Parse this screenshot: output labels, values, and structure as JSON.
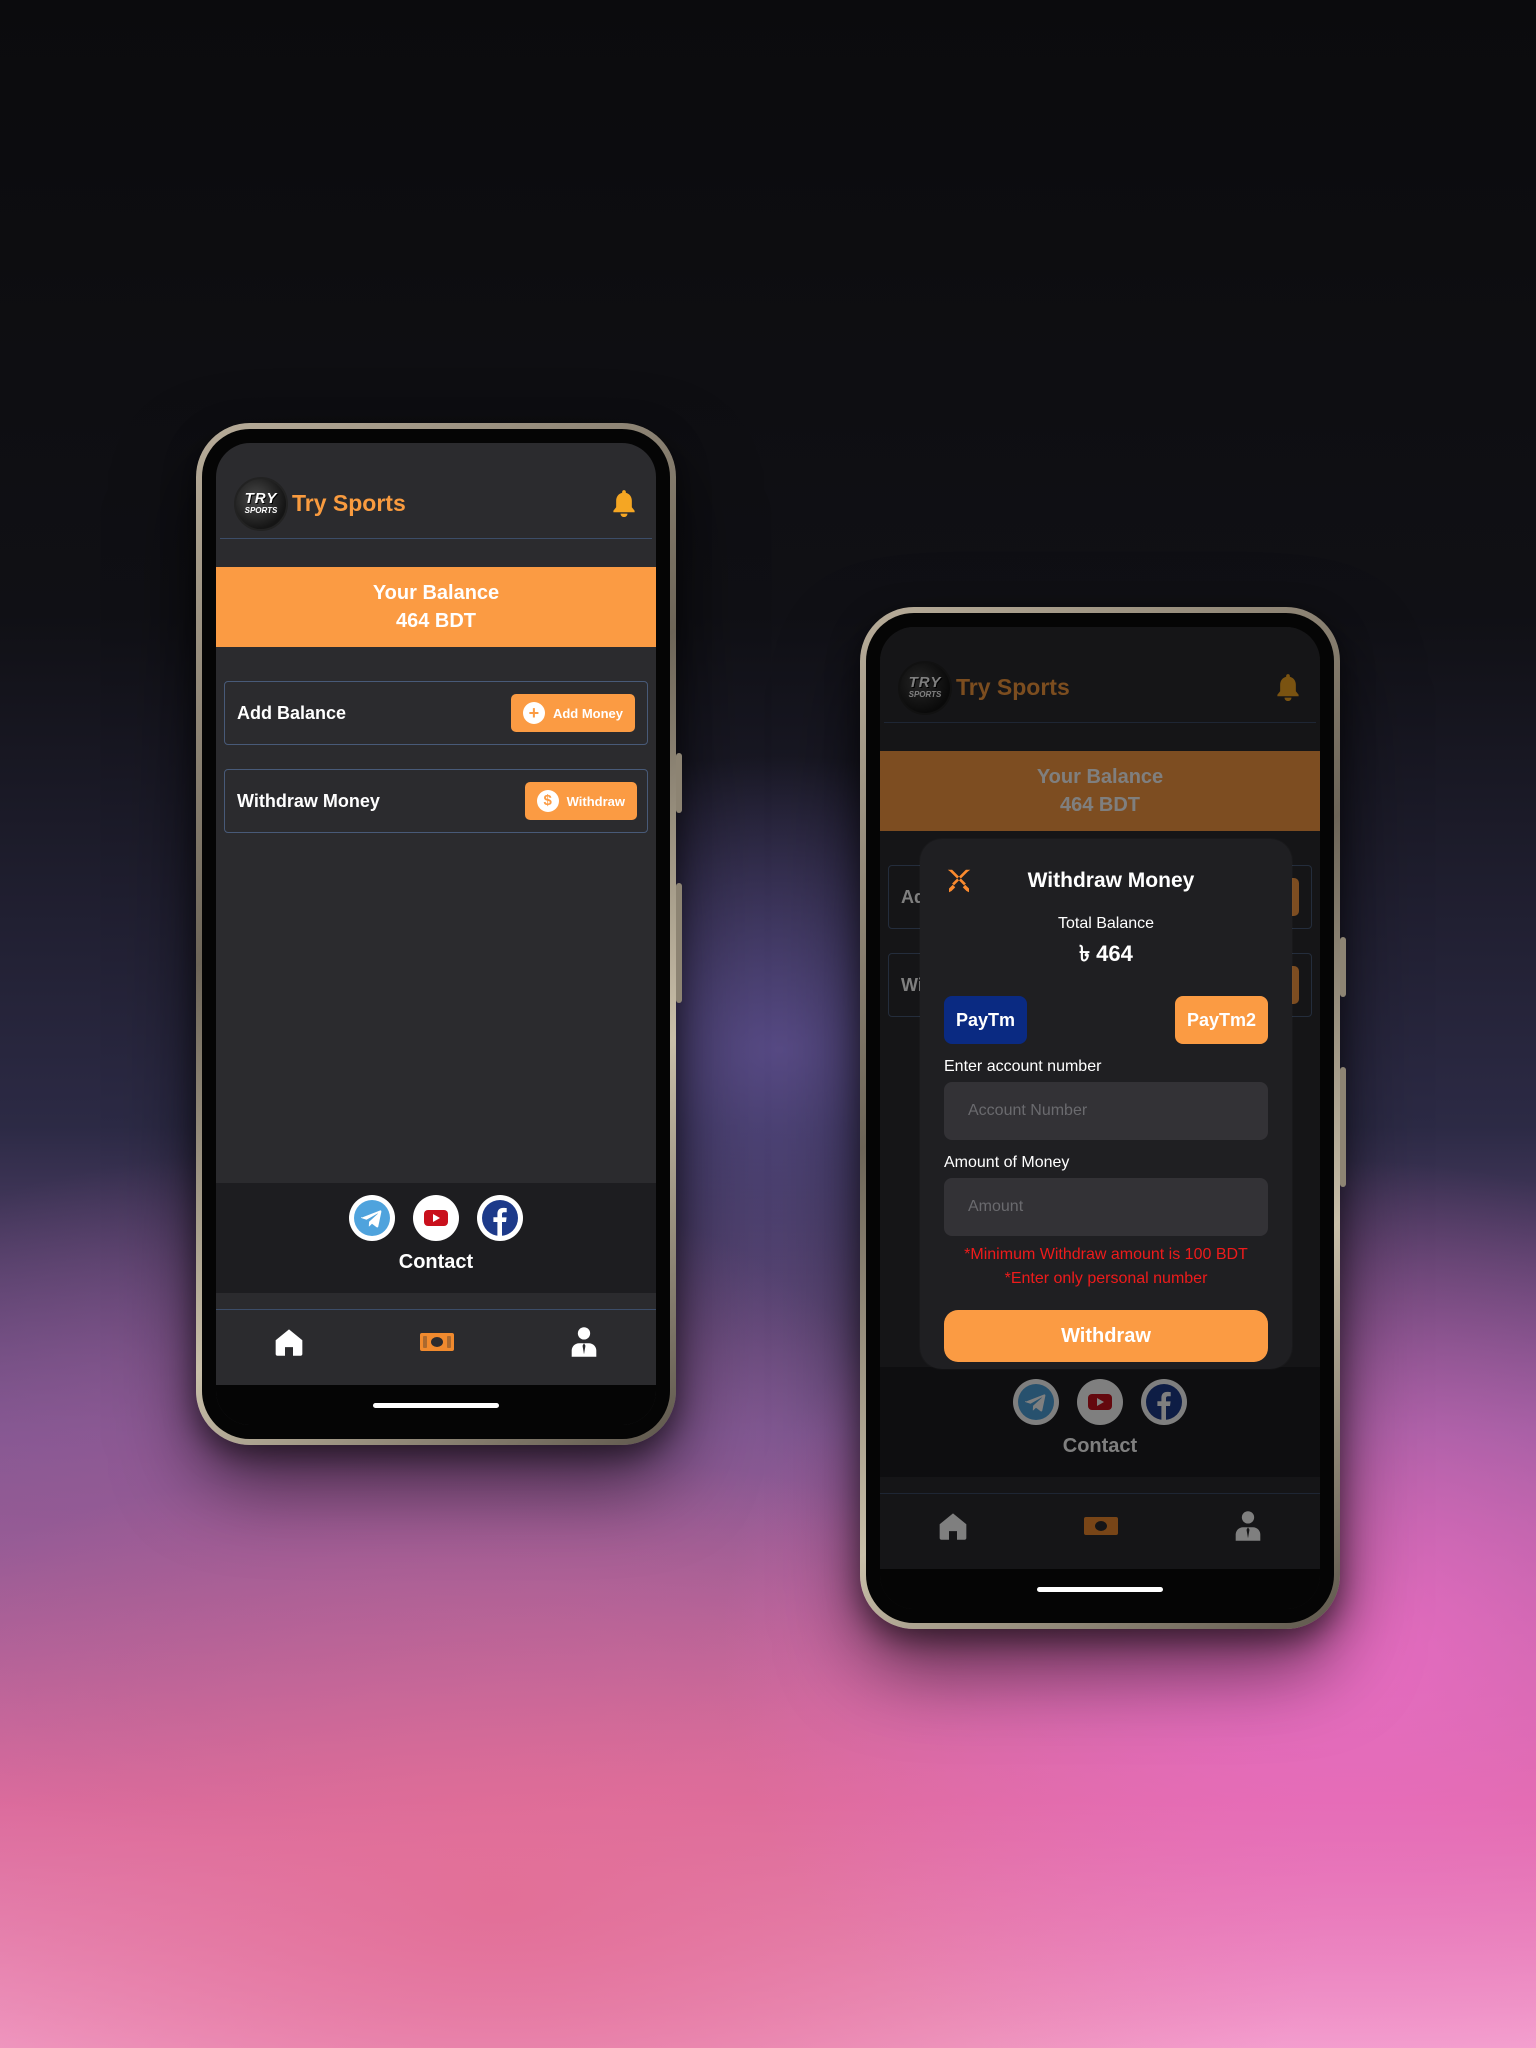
{
  "app": {
    "title": "Try Sports",
    "logo_line1": "TRY",
    "logo_line2": "SPORTS"
  },
  "colors": {
    "accent": "#fb9b43",
    "paytm": "#0a2a82",
    "warning": "#ee1b1b",
    "screen_bg": "#2b2b2e"
  },
  "icons": {
    "bell": "bell-icon",
    "plus": "plus-circle-icon",
    "dollar": "dollar-circle-icon",
    "telegram": "telegram-icon",
    "youtube": "youtube-icon",
    "facebook": "facebook-icon",
    "home": "home-icon",
    "money": "money-icon",
    "profile": "profile-icon",
    "close": "crossed-swords-icon"
  },
  "home_screen": {
    "balance_label": "Your Balance",
    "balance_value": "464 BDT",
    "add_balance": {
      "label": "Add Balance",
      "button": "Add Money"
    },
    "withdraw_money": {
      "label": "Withdraw Money",
      "button": "Withdraw"
    },
    "contact_label": "Contact"
  },
  "withdraw_screen": {
    "bg_row1_label": "Ad",
    "bg_row2_label": "Wi",
    "modal": {
      "title": "Withdraw Money",
      "total_balance_label": "Total Balance",
      "total_balance_value": "৳ 464",
      "payment_methods": [
        "PayTm",
        "PayTm2"
      ],
      "account_label": "Enter account number",
      "account_placeholder": "Account Number",
      "amount_label": "Amount of Money",
      "amount_placeholder": "Amount",
      "warning_min": "*Minimum Withdraw amount is 100 BDT",
      "warning_personal": "*Enter only personal number",
      "submit": "Withdraw"
    }
  }
}
